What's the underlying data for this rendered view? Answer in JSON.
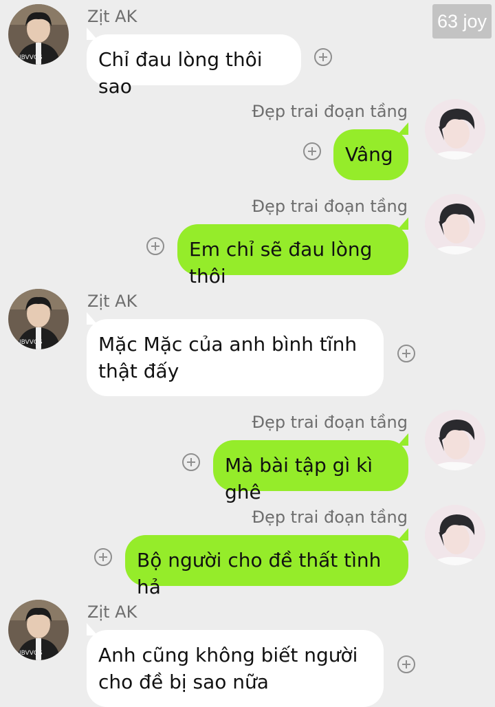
{
  "watermark": "63 joy",
  "contacts": {
    "other": "Zịt AK",
    "self": "Đẹp trai đoạn tầng"
  },
  "messages": [
    {
      "sender": "Zịt AK",
      "text": "Chỉ đau lòng thôi sao"
    },
    {
      "sender": "Đẹp trai đoạn tầng",
      "text": "Vâng"
    },
    {
      "sender": "Đẹp trai đoạn tầng",
      "text": "Em chỉ sẽ đau lòng thôi"
    },
    {
      "sender": "Zịt AK",
      "text": "Mặc Mặc của anh bình tĩnh thật đấy"
    },
    {
      "sender": "Đẹp trai đoạn tầng",
      "text": "Mà bài tập gì kì ghê"
    },
    {
      "sender": "Đẹp trai đoạn tầng",
      "text": "Bộ người cho đề thất tình hả"
    },
    {
      "sender": "Zịt AK",
      "text": "Anh cũng không biết người cho đề bị sao nữa"
    }
  ],
  "colors": {
    "background": "#ededed",
    "sent_bubble": "#95ec2a",
    "received_bubble": "#ffffff"
  },
  "icons": {
    "add_reaction": "plus-circle-icon"
  }
}
